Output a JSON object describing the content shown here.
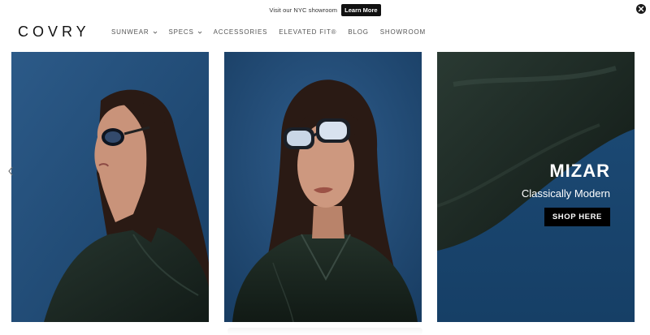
{
  "announcement": {
    "text": "Visit our NYC showroom",
    "button_label": "Learn More"
  },
  "header": {
    "logo": "COVRY",
    "nav": [
      {
        "label": "SUNWEAR",
        "has_dropdown": true
      },
      {
        "label": "SPECS",
        "has_dropdown": true
      },
      {
        "label": "ACCESSORIES",
        "has_dropdown": false
      },
      {
        "label": "ELEVATED FIT®",
        "has_dropdown": false
      },
      {
        "label": "BLOG",
        "has_dropdown": false
      },
      {
        "label": "SHOWROOM",
        "has_dropdown": false
      }
    ]
  },
  "hero": {
    "product_name": "MIZAR",
    "tagline": "Classically Modern",
    "cta_label": "SHOP HERE"
  },
  "icons": {
    "close": "close-icon",
    "prev": "chevron-left-icon",
    "next": "chevron-right-icon",
    "dropdown": "chevron-down-icon"
  },
  "colors": {
    "backdrop_blue": "#1f4d7a",
    "jacket_green": "#1c2a24",
    "hair": "#2a1a14",
    "cta_bg": "#000000"
  }
}
